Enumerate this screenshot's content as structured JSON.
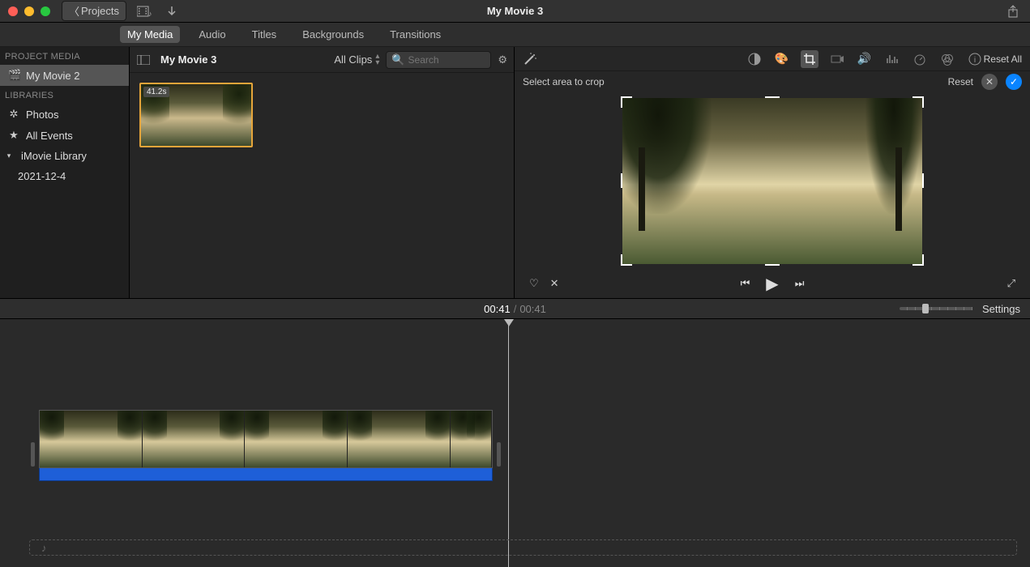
{
  "titlebar": {
    "back_label": "Projects",
    "window_title": "My Movie 3"
  },
  "media_tabs": {
    "my_media": "My Media",
    "audio": "Audio",
    "titles": "Titles",
    "backgrounds": "Backgrounds",
    "transitions": "Transitions"
  },
  "sidebar": {
    "section_project": "PROJECT MEDIA",
    "project_item": "My Movie 2",
    "section_libraries": "LIBRARIES",
    "photos": "Photos",
    "all_events": "All Events",
    "library": "iMovie Library",
    "event_date": "2021-12-4"
  },
  "browser": {
    "title": "My Movie 3",
    "filter_label": "All Clips",
    "search_placeholder": "Search",
    "clip_duration": "41.2s"
  },
  "viewer": {
    "reset_all": "Reset All",
    "crop_hint": "Select area to crop",
    "reset": "Reset"
  },
  "timebar": {
    "current": "00:41",
    "duration": "00:41",
    "settings": "Settings"
  }
}
